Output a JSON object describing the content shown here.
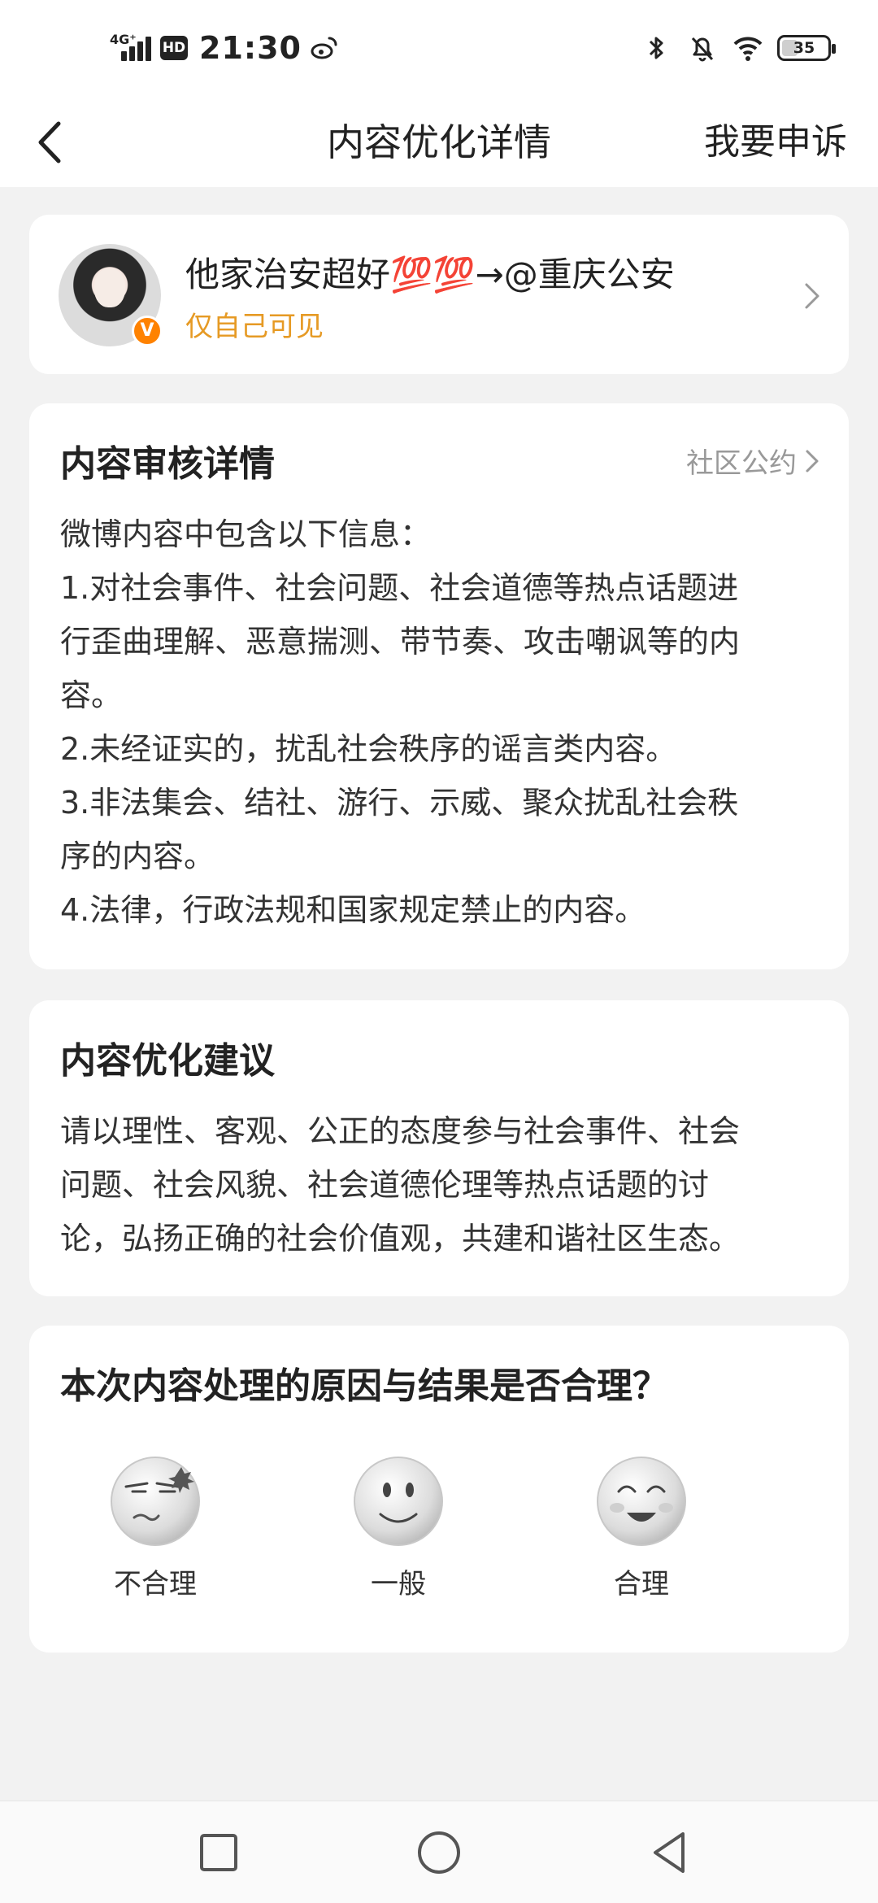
{
  "status_bar": {
    "network": "4G⁺",
    "hd": "HD",
    "time": "21:30",
    "battery": "35",
    "battery_percent": 35,
    "icons": [
      "signal-icon",
      "weibo-icon",
      "bluetooth-icon",
      "mute-icon",
      "wifi-icon",
      "battery-icon"
    ]
  },
  "nav": {
    "title": "内容优化详情",
    "action": "我要申诉",
    "back_icon": "back-arrow-icon"
  },
  "post": {
    "text": "他家治安超好💯💯→@重庆公安",
    "visibility": "仅自己可见",
    "badge": "V"
  },
  "review": {
    "title": "内容审核详情",
    "link": "社区公约",
    "lines": [
      "微博内容中包含以下信息：",
      "1.对社会事件、社会问题、社会道德等热点话题进",
      "行歪曲理解、恶意揣测、带节奏、攻击嘲讽等的内",
      "容。",
      "2.未经证实的，扰乱社会秩序的谣言类内容。",
      "3.非法集会、结社、游行、示威、聚众扰乱社会秩",
      "序的内容。",
      "4.法律，行政法规和国家规定禁止的内容。"
    ]
  },
  "suggestion": {
    "title": "内容优化建议",
    "lines": [
      "请以理性、客观、公正的态度参与社会事件、社会",
      "问题、社会风貌、社会道德伦理等热点话题的讨",
      "论，弘扬正确的社会价值观，共建和谐社区生态。"
    ]
  },
  "feedback": {
    "question": "本次内容处理的原因与结果是否合理？",
    "options": [
      {
        "label": "不合理",
        "icon": "annoyed-face-icon"
      },
      {
        "label": "一般",
        "icon": "neutral-face-icon"
      },
      {
        "label": "合理",
        "icon": "happy-face-icon"
      }
    ]
  },
  "colors": {
    "background": "#f2f2f2",
    "card": "#ffffff",
    "visibility_text": "#e69a24",
    "verified_badge": "#ff8200",
    "secondary_text": "#999999"
  }
}
